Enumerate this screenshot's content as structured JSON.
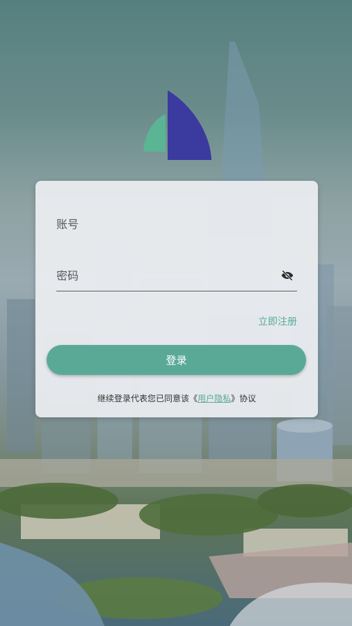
{
  "form": {
    "account_placeholder": "账号",
    "password_placeholder": "密码",
    "register_label": "立即注册",
    "login_label": "登录"
  },
  "agreement": {
    "prefix": "继续登录代表您已同意该《",
    "link": "用户隐私",
    "suffix": "》协议"
  },
  "colors": {
    "accent": "#5aa996",
    "logo_blue": "#3b3a9e",
    "logo_green": "#5bb494"
  },
  "icons": {
    "password_toggle": "eye-slash-icon",
    "logo": "sail-logo"
  }
}
